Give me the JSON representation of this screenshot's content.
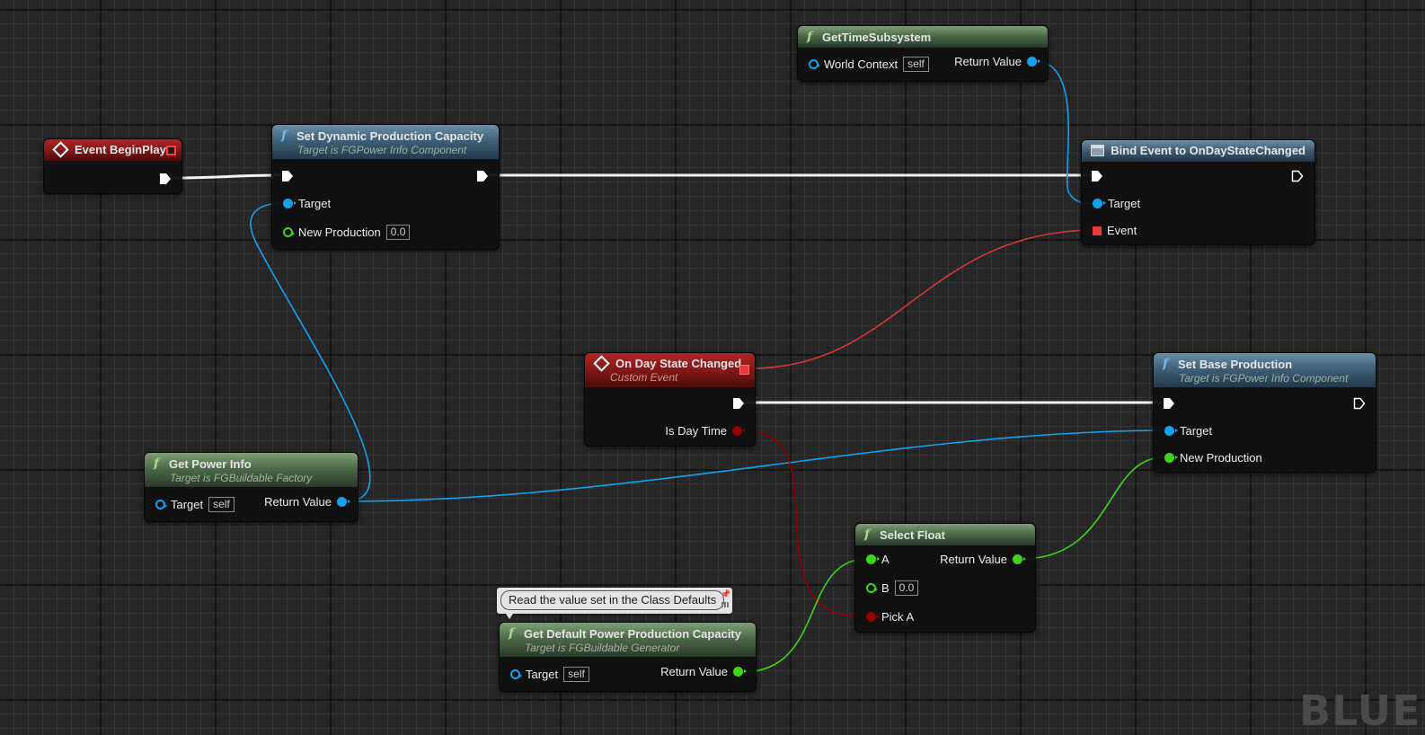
{
  "graph": {
    "watermark": "BLUEPRINT",
    "colors": {
      "exec": "#ffffff",
      "object": "#13a2ee",
      "float": "#3fd41b",
      "bool": "#8f0000",
      "delegate": "#e83a3a",
      "function_header": "#3f6078",
      "pure_header": "#4d6a48",
      "event_header": "#7f1616"
    }
  },
  "nodes": {
    "event_begin_play": {
      "title": "Event BeginPlay"
    },
    "set_dynamic_production": {
      "title": "Set Dynamic Production Capacity",
      "subtitle": "Target is FGPower Info Component",
      "pins": {
        "target": "Target",
        "new_production": "New Production",
        "new_production_value": "0.0"
      }
    },
    "get_time_subsystem": {
      "title": "GetTimeSubsystem",
      "pins": {
        "world_context": "World Context",
        "world_context_value": "self",
        "return_value": "Return Value"
      }
    },
    "bind_event": {
      "title": "Bind Event to OnDayStateChanged",
      "pins": {
        "target": "Target",
        "event": "Event"
      }
    },
    "on_day_state_changed": {
      "title": "On Day State Changed",
      "subtitle": "Custom Event",
      "pins": {
        "is_day_time": "Is Day Time"
      }
    },
    "set_base_production": {
      "title": "Set Base Production",
      "subtitle": "Target is FGPower Info Component",
      "pins": {
        "target": "Target",
        "new_production": "New Production"
      }
    },
    "get_power_info": {
      "title": "Get Power Info",
      "subtitle": "Target is FGBuildable Factory",
      "pins": {
        "target": "Target",
        "target_value": "self",
        "return_value": "Return Value"
      }
    },
    "select_float": {
      "title": "Select Float",
      "pins": {
        "a": "A",
        "b": "B",
        "b_value": "0.0",
        "pick_a": "Pick A",
        "return_value": "Return Value"
      }
    },
    "get_default_power": {
      "title": "Get Default Power Production Capacity",
      "subtitle": "Target is FGBuildable Generator",
      "comment": "Read the value set in the Class Defaults",
      "pins": {
        "target": "Target",
        "target_value": "self",
        "return_value": "Return Value"
      }
    }
  }
}
